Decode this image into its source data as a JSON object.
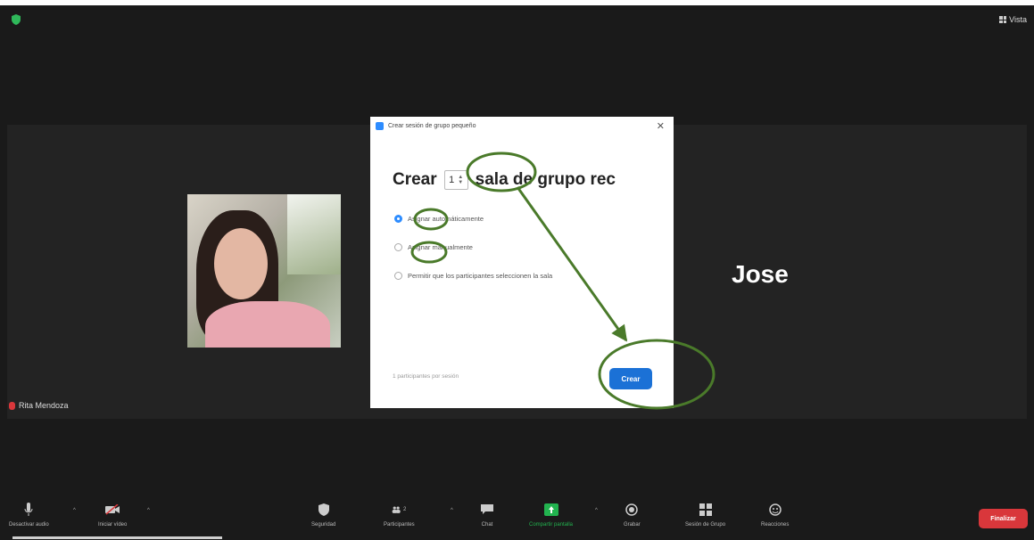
{
  "header": {
    "view_label": "Vista"
  },
  "participants": {
    "left_name": "Rita Mendoza",
    "right_name": "Jose"
  },
  "dialog": {
    "title": "Crear sesión de grupo pequeño",
    "close_icon": "close-icon",
    "headline_prefix": "Crear",
    "room_count": "1",
    "headline_suffix": "sala de grupo rec",
    "options": [
      {
        "label": "Asignar automáticamente",
        "selected": true
      },
      {
        "label": "Asignar manualmente",
        "selected": false
      },
      {
        "label": "Permitir que los participantes seleccionen la sala",
        "selected": false
      }
    ],
    "per_room_text": "1 participantes por sesión",
    "create_label": "Crear"
  },
  "toolbar": {
    "items": [
      {
        "label": "Desactivar audio",
        "icon": "mic-icon"
      },
      {
        "label": "Iniciar vídeo",
        "icon": "video-off-icon"
      },
      {
        "label": "Seguridad",
        "icon": "shield-icon"
      },
      {
        "label": "Participantes",
        "icon": "participants-icon",
        "count": "2"
      },
      {
        "label": "Chat",
        "icon": "chat-icon"
      },
      {
        "label": "Compartir pantalla",
        "icon": "share-screen-icon"
      },
      {
        "label": "Grabar",
        "icon": "record-icon"
      },
      {
        "label": "Sesión de Grupo",
        "icon": "breakout-icon"
      },
      {
        "label": "Reacciones",
        "icon": "reactions-icon"
      }
    ],
    "end_label": "Finalizar"
  },
  "colors": {
    "accent": "#2d8cff",
    "create_button": "#1b71d6",
    "annotation": "#4a7a2a",
    "share": "#22b34f",
    "end": "#d9373b",
    "security_shield": "#2fb85a"
  }
}
